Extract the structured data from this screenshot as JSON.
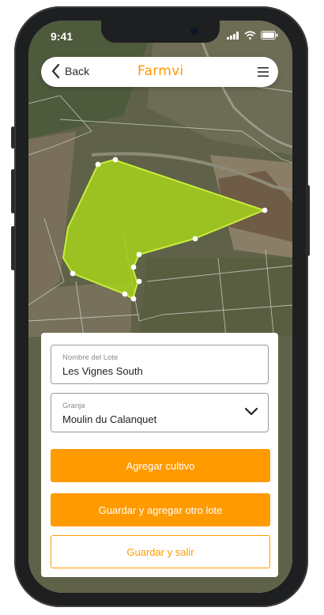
{
  "status_bar": {
    "time": "9:41"
  },
  "header": {
    "back_label": "Back",
    "logo_text": "Farmvi"
  },
  "form": {
    "lot_name_label": "Nombre del Lote",
    "lot_name_value": "Les Vignes South",
    "farm_label": "Granja",
    "farm_value": "Moulin du Calanquet"
  },
  "actions": {
    "add_crop": "Agregar cultivo",
    "save_add_another": "Guardar y agregar otro lote",
    "save_exit": "Guardar y salir"
  },
  "colors": {
    "accent": "#ff9a00",
    "field_polygon": "#a8d81a",
    "polygon_border": "#c8ee3a"
  },
  "icons": [
    "chevron-left-icon",
    "hamburger-menu-icon",
    "chevron-down-icon",
    "signal-icon",
    "wifi-icon",
    "battery-icon",
    "vertex-handle-icon"
  ]
}
